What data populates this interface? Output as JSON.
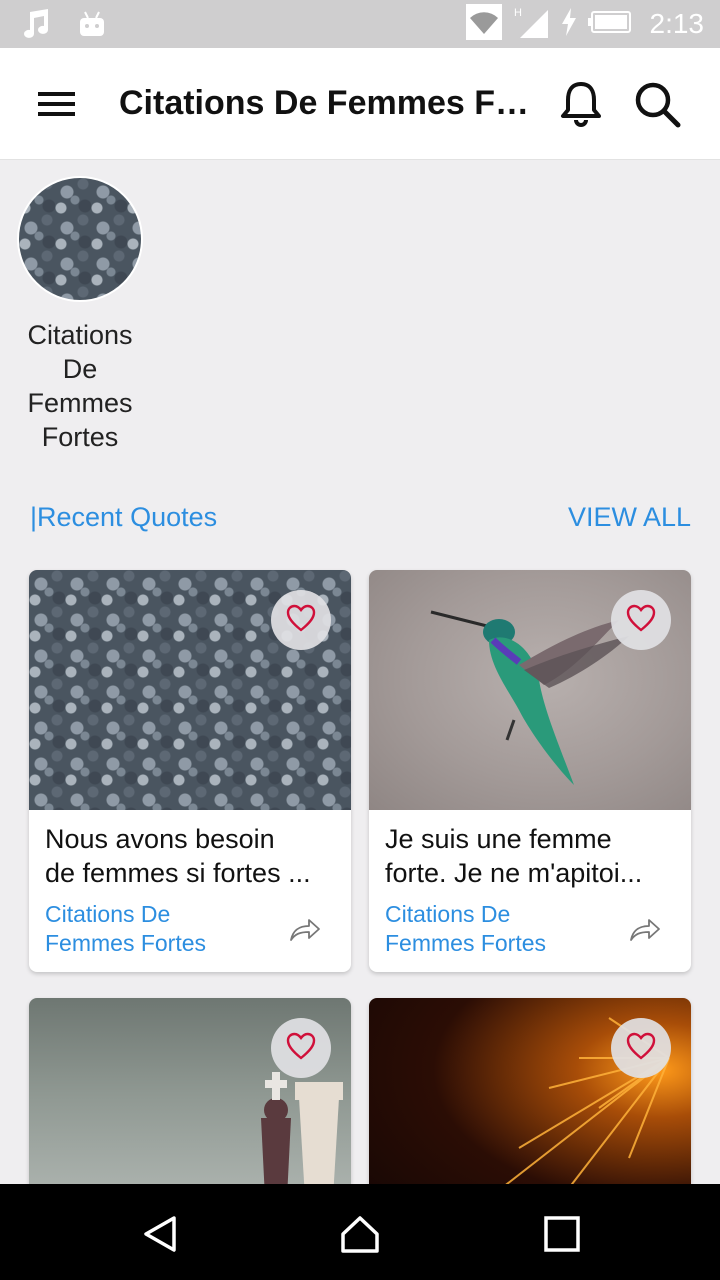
{
  "status_bar": {
    "time": "2:13",
    "left_icons": [
      "music-note-icon",
      "android-icon"
    ],
    "right_icons": [
      "wifi-icon",
      "signal-h-icon",
      "charging-icon",
      "battery-icon"
    ]
  },
  "app_bar": {
    "title": "Citations De Femmes Fortes",
    "menu_icon": "hamburger-menu-icon",
    "bell_icon": "notification-bell-icon",
    "search_icon": "search-icon"
  },
  "category": {
    "label_lines": [
      "Citations",
      "De",
      "Femmes",
      "Fortes"
    ]
  },
  "recent": {
    "title": "|Recent Quotes",
    "view_all": "VIEW ALL"
  },
  "cards": [
    {
      "text_line1": "Nous avons besoin",
      "text_line2": "de femmes si fortes ...",
      "category_line1": "Citations De",
      "category_line2": "Femmes Fortes"
    },
    {
      "text_line1": "Je suis une femme",
      "text_line2": "forte. Je ne m'apitoi...",
      "category_line1": "Citations De",
      "category_line2": "Femmes Fortes"
    },
    {
      "text_line1": "",
      "text_line2": "",
      "category_line1": "",
      "category_line2": ""
    },
    {
      "text_line1": "",
      "text_line2": "",
      "category_line1": "",
      "category_line2": ""
    }
  ],
  "colors": {
    "accent": "#2c8ee0",
    "heart": "#d0103a",
    "background": "#efeef0"
  }
}
